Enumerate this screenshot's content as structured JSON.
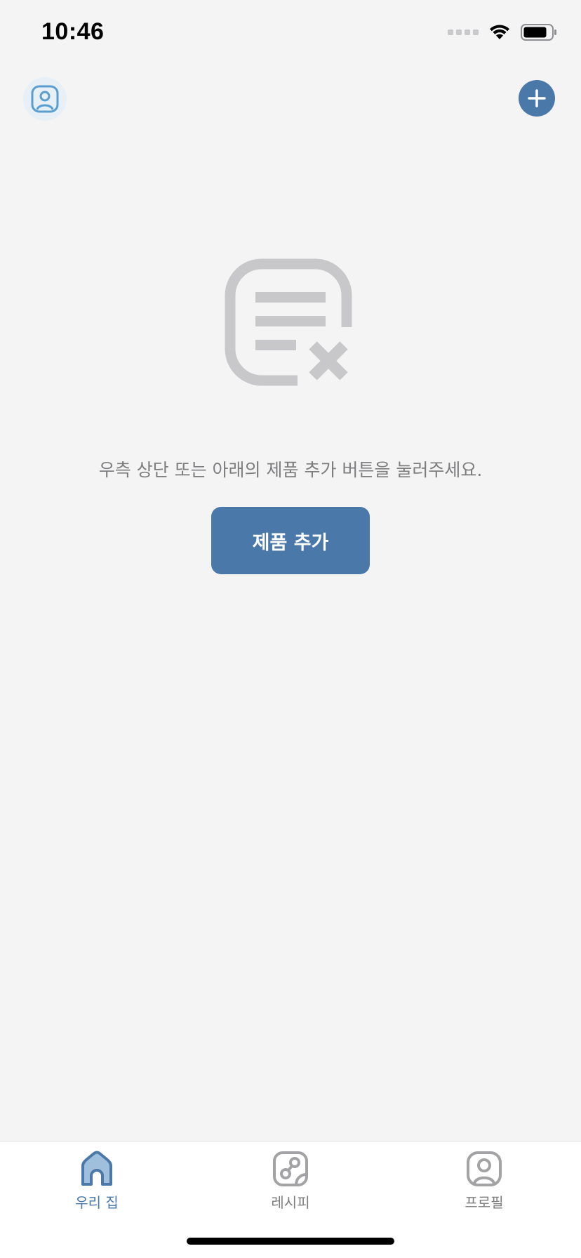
{
  "status_bar": {
    "time": "10:46"
  },
  "header": {
    "profile_icon": "profile-icon",
    "add_icon": "plus-icon"
  },
  "empty_state": {
    "icon": "empty-list-icon",
    "message": "우측 상단 또는 아래의 제품 추가 버튼을 눌러주세요.",
    "button_label": "제품 추가"
  },
  "tab_bar": {
    "items": [
      {
        "label": "우리 집",
        "icon": "home-icon",
        "active": true
      },
      {
        "label": "레시피",
        "icon": "recipe-icon",
        "active": false
      },
      {
        "label": "프로필",
        "icon": "profile-icon",
        "active": false
      }
    ]
  },
  "colors": {
    "accent": "#4a78a8",
    "background": "#f4f4f5",
    "muted_text": "#7d7d7f",
    "icon_gray": "#c8c8ca"
  }
}
